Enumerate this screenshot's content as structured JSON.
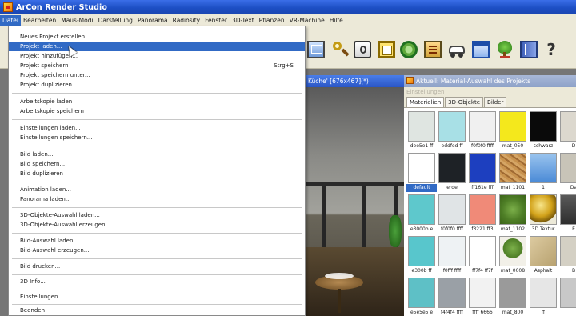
{
  "window": {
    "title": "ArCon Render Studio"
  },
  "menubar": {
    "items": [
      "Datei",
      "Bearbeiten",
      "Maus-Modi",
      "Darstellung",
      "Panorama",
      "Radiosity",
      "Fenster",
      "3D-Text",
      "Pflanzen",
      "VR-Machine",
      "Hilfe"
    ]
  },
  "file_menu": {
    "new_project": "Neues Projekt erstellen",
    "load_project": "Projekt laden...",
    "add_project": "Projekt hinzufügen...",
    "save_project": "Projekt speichern",
    "save_project_shortcut": "Strg+S",
    "save_project_as": "Projekt speichern unter...",
    "duplicate_project": "Projekt duplizieren",
    "load_working_copy": "Arbeitskopie laden",
    "save_working_copy": "Arbeitskopie speichern",
    "load_settings": "Einstellungen laden...",
    "save_settings": "Einstellungen speichern...",
    "load_image": "Bild laden...",
    "save_image": "Bild speichern...",
    "duplicate_image": "Bild duplizieren",
    "load_animation": "Animation laden...",
    "load_panorama": "Panorama laden...",
    "load_3d_selection": "3D-Objekte-Auswahl laden...",
    "create_3d_selection": "3D-Objekte-Auswahl erzeugen...",
    "load_image_selection": "Bild-Auswahl laden...",
    "create_image_selection": "Bild-Auswahl erzeugen...",
    "print_image": "Bild drucken...",
    "info_3d": "3D Info...",
    "settings": "Einstellungen...",
    "exit": "Beenden"
  },
  "toolbar": {
    "help_glyph": "?"
  },
  "viewport": {
    "title": "Küche' [676x467](*)"
  },
  "material_panel": {
    "title": "Aktuell: Material-Auswahl des Projekts",
    "subtitle": "Einstellungen",
    "tabs": [
      "Materialien",
      "3D-Objekte",
      "Bilder"
    ],
    "swatches": [
      {
        "label": "dee5e1 ff",
        "color": "#dfe5e1"
      },
      {
        "label": "eddfed ff",
        "color": "#a8e0e6"
      },
      {
        "label": "f0f0f0 ffff",
        "color": "#f0f0f0"
      },
      {
        "label": "mat_050",
        "color": "#f4e81c"
      },
      {
        "label": "schwarz",
        "color": "#0a0a0a"
      },
      {
        "label": "D",
        "color": "#dcd8ce"
      },
      {
        "label": "default",
        "color": "#ffffff"
      },
      {
        "label": "erde",
        "color": "#1e2226"
      },
      {
        "label": "ff161e fff",
        "color": "#1d3fbf"
      },
      {
        "label": "mat_1101",
        "color": "texture-wood"
      },
      {
        "label": "1",
        "color": "texture-water"
      },
      {
        "label": "Da",
        "color": "#c8c4b8"
      },
      {
        "label": "e3000b e",
        "color": "#5ec8cc"
      },
      {
        "label": "f0f0f0 ffff",
        "color": "#e0e4e6"
      },
      {
        "label": "f3221 ff3",
        "color": "#f08a78"
      },
      {
        "label": "mat_1102",
        "color": "texture-grass"
      },
      {
        "label": "3D Textur",
        "color": "texture-sphere"
      },
      {
        "label": "E",
        "color": "texture-dark"
      },
      {
        "label": "e300b ff",
        "color": "#58c6cc"
      },
      {
        "label": "f0fff ffff",
        "color": "#eef2f4"
      },
      {
        "label": "ff7f4 ff7f",
        "color": "#ffffff"
      },
      {
        "label": "mat_0008",
        "color": "texture-tree"
      },
      {
        "label": "Asphalt",
        "color": "texture-asphalt"
      },
      {
        "label": "B",
        "color": "#d4d0c4"
      },
      {
        "label": "e5e5e5 e",
        "color": "#5ec0c6"
      },
      {
        "label": "f4f4f4 ffff",
        "color": "#9aa0a6"
      },
      {
        "label": "ffff 6666",
        "color": "#f2f2f2"
      },
      {
        "label": "mat_800",
        "color": "#9a9a9a"
      },
      {
        "label": "ff",
        "color": "#e6e6e6"
      },
      {
        "label": "",
        "color": "#c8c8c8"
      }
    ]
  },
  "colors": {
    "titlebar": "#1d4fc4",
    "menu_highlight": "#316ac5",
    "chrome": "#ece9d8"
  }
}
